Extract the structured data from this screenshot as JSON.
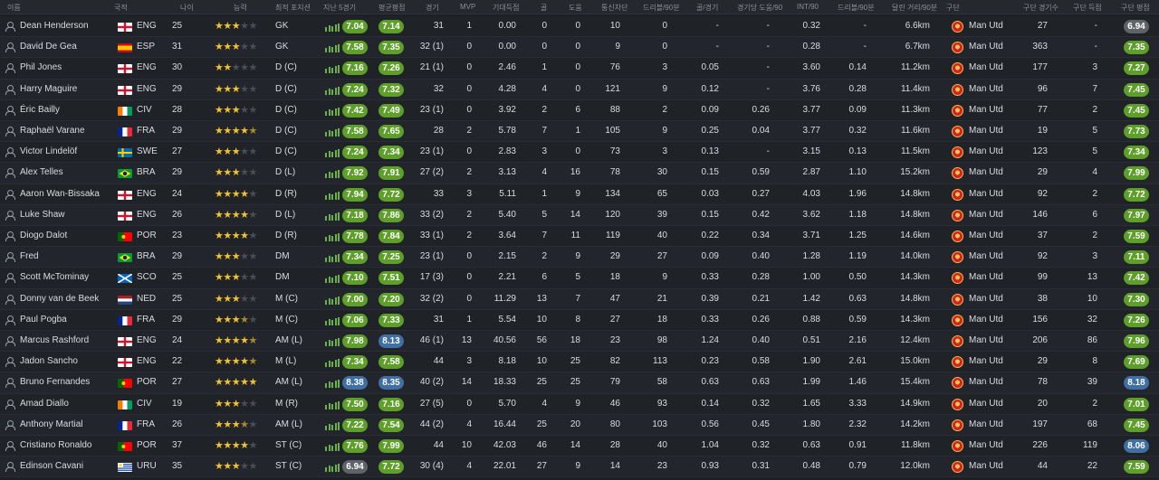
{
  "columns": [
    "이름",
    "국적",
    "나이",
    "능력",
    "최적 포지션",
    "지난 5경기",
    "평균평점",
    "경기",
    "MVP",
    "기대득점",
    "골",
    "도움",
    "통신차단",
    "드리블/90분",
    "골/경기",
    "경기당 도움/90",
    "INT/90",
    "드리블/90분",
    "달린 거리/90분",
    "구단",
    "구단 경기수",
    "구단 득점",
    "구단 평점"
  ],
  "colors": {
    "good": "#5e9f2a",
    "great": "#3f6fa3",
    "neutral": "#5f6368"
  },
  "players": [
    {
      "name": "Dean Henderson",
      "nat": "ENG",
      "flag": "eng",
      "age": "25",
      "stars": [
        1,
        1,
        1,
        0,
        0
      ],
      "pos": "GK",
      "last5": "7.04",
      "avg": "7.14",
      "apps": "31",
      "mvp": "1",
      "xg": "0.00",
      "goals": "0",
      "assists": "0",
      "intc": "10",
      "drb": "0",
      "gpg": "-",
      "apg": "-",
      "int90": "0.32",
      "drb90": "-",
      "dist": "6.6km",
      "club": "Man Utd",
      "capps": "27",
      "cgoals": "-",
      "crating": "6.94",
      "last5c": "good",
      "avgc": "good",
      "cratc": "neutral"
    },
    {
      "name": "David De Gea",
      "nat": "ESP",
      "flag": "esp",
      "age": "31",
      "stars": [
        1,
        1,
        1,
        0,
        0
      ],
      "pos": "GK",
      "last5": "7.58",
      "avg": "7.35",
      "apps": "32 (1)",
      "mvp": "0",
      "xg": "0.00",
      "goals": "0",
      "assists": "0",
      "intc": "9",
      "drb": "0",
      "gpg": "-",
      "apg": "-",
      "int90": "0.28",
      "drb90": "-",
      "dist": "6.7km",
      "club": "Man Utd",
      "capps": "363",
      "cgoals": "-",
      "crating": "7.35",
      "last5c": "good",
      "avgc": "good",
      "cratc": "good"
    },
    {
      "name": "Phil Jones",
      "nat": "ENG",
      "flag": "eng",
      "age": "30",
      "stars": [
        1,
        1,
        0,
        0,
        0
      ],
      "pos": "D (C)",
      "last5": "7.16",
      "avg": "7.26",
      "apps": "21 (1)",
      "mvp": "0",
      "xg": "2.46",
      "goals": "1",
      "assists": "0",
      "intc": "76",
      "drb": "3",
      "gpg": "0.05",
      "apg": "-",
      "int90": "3.60",
      "drb90": "0.14",
      "dist": "11.2km",
      "club": "Man Utd",
      "capps": "177",
      "cgoals": "3",
      "crating": "7.27",
      "last5c": "good",
      "avgc": "good",
      "cratc": "good"
    },
    {
      "name": "Harry Maguire",
      "nat": "ENG",
      "flag": "eng",
      "age": "29",
      "stars": [
        1,
        1,
        1,
        0,
        0
      ],
      "pos": "D (C)",
      "last5": "7.24",
      "avg": "7.32",
      "apps": "32",
      "mvp": "0",
      "xg": "4.28",
      "goals": "4",
      "assists": "0",
      "intc": "121",
      "drb": "9",
      "gpg": "0.12",
      "apg": "-",
      "int90": "3.76",
      "drb90": "0.28",
      "dist": "11.4km",
      "club": "Man Utd",
      "capps": "96",
      "cgoals": "7",
      "crating": "7.45",
      "last5c": "good",
      "avgc": "good",
      "cratc": "good"
    },
    {
      "name": "Éric Bailly",
      "nat": "CIV",
      "flag": "civ",
      "age": "28",
      "stars": [
        1,
        1,
        1,
        0,
        0
      ],
      "pos": "D (C)",
      "last5": "7.42",
      "avg": "7.49",
      "apps": "23 (1)",
      "mvp": "0",
      "xg": "3.92",
      "goals": "2",
      "assists": "6",
      "intc": "88",
      "drb": "2",
      "gpg": "0.09",
      "apg": "0.26",
      "int90": "3.77",
      "drb90": "0.09",
      "dist": "11.3km",
      "club": "Man Utd",
      "capps": "77",
      "cgoals": "2",
      "crating": "7.45",
      "last5c": "good",
      "avgc": "good",
      "cratc": "good"
    },
    {
      "name": "Raphaël Varane",
      "nat": "FRA",
      "flag": "fra",
      "age": "29",
      "stars": [
        1,
        1,
        1,
        1,
        0.5
      ],
      "pos": "D (C)",
      "last5": "7.58",
      "avg": "7.65",
      "apps": "28",
      "mvp": "2",
      "xg": "5.78",
      "goals": "7",
      "assists": "1",
      "intc": "105",
      "drb": "9",
      "gpg": "0.25",
      "apg": "0.04",
      "int90": "3.77",
      "drb90": "0.32",
      "dist": "11.6km",
      "club": "Man Utd",
      "capps": "19",
      "cgoals": "5",
      "crating": "7.73",
      "last5c": "good",
      "avgc": "good",
      "cratc": "good"
    },
    {
      "name": "Victor Lindelöf",
      "nat": "SWE",
      "flag": "swe",
      "age": "27",
      "stars": [
        1,
        1,
        1,
        0,
        0
      ],
      "pos": "D (C)",
      "last5": "7.24",
      "avg": "7.34",
      "apps": "23 (1)",
      "mvp": "0",
      "xg": "2.83",
      "goals": "3",
      "assists": "0",
      "intc": "73",
      "drb": "3",
      "gpg": "0.13",
      "apg": "-",
      "int90": "3.15",
      "drb90": "0.13",
      "dist": "11.5km",
      "club": "Man Utd",
      "capps": "123",
      "cgoals": "5",
      "crating": "7.34",
      "last5c": "good",
      "avgc": "good",
      "cratc": "good"
    },
    {
      "name": "Alex Telles",
      "nat": "BRA",
      "flag": "bra",
      "age": "29",
      "stars": [
        1,
        1,
        1,
        0,
        0
      ],
      "pos": "D (L)",
      "last5": "7.92",
      "avg": "7.91",
      "apps": "27 (2)",
      "mvp": "2",
      "xg": "3.13",
      "goals": "4",
      "assists": "16",
      "intc": "78",
      "drb": "30",
      "gpg": "0.15",
      "apg": "0.59",
      "int90": "2.87",
      "drb90": "1.10",
      "dist": "15.2km",
      "club": "Man Utd",
      "capps": "29",
      "cgoals": "4",
      "crating": "7.99",
      "last5c": "good",
      "avgc": "good",
      "cratc": "good"
    },
    {
      "name": "Aaron Wan-Bissaka",
      "nat": "ENG",
      "flag": "eng",
      "age": "24",
      "stars": [
        1,
        1,
        1,
        1,
        0
      ],
      "pos": "D (R)",
      "last5": "7.94",
      "avg": "7.72",
      "apps": "33",
      "mvp": "3",
      "xg": "5.11",
      "goals": "1",
      "assists": "9",
      "intc": "134",
      "drb": "65",
      "gpg": "0.03",
      "apg": "0.27",
      "int90": "4.03",
      "drb90": "1.96",
      "dist": "14.8km",
      "club": "Man Utd",
      "capps": "92",
      "cgoals": "2",
      "crating": "7.72",
      "last5c": "good",
      "avgc": "good",
      "cratc": "good"
    },
    {
      "name": "Luke Shaw",
      "nat": "ENG",
      "flag": "eng",
      "age": "26",
      "stars": [
        1,
        1,
        1,
        1,
        0
      ],
      "pos": "D (L)",
      "last5": "7.18",
      "avg": "7.86",
      "apps": "33 (2)",
      "mvp": "2",
      "xg": "5.40",
      "goals": "5",
      "assists": "14",
      "intc": "120",
      "drb": "39",
      "gpg": "0.15",
      "apg": "0.42",
      "int90": "3.62",
      "drb90": "1.18",
      "dist": "14.8km",
      "club": "Man Utd",
      "capps": "146",
      "cgoals": "6",
      "crating": "7.97",
      "last5c": "good",
      "avgc": "good",
      "cratc": "good"
    },
    {
      "name": "Diogo Dalot",
      "nat": "POR",
      "flag": "por",
      "age": "23",
      "stars": [
        1,
        1,
        1,
        1,
        0
      ],
      "pos": "D (R)",
      "last5": "7.78",
      "avg": "7.84",
      "apps": "33 (1)",
      "mvp": "2",
      "xg": "3.64",
      "goals": "7",
      "assists": "11",
      "intc": "119",
      "drb": "40",
      "gpg": "0.22",
      "apg": "0.34",
      "int90": "3.71",
      "drb90": "1.25",
      "dist": "14.6km",
      "club": "Man Utd",
      "capps": "37",
      "cgoals": "2",
      "crating": "7.59",
      "last5c": "good",
      "avgc": "good",
      "cratc": "good"
    },
    {
      "name": "Fred",
      "nat": "BRA",
      "flag": "bra",
      "age": "29",
      "stars": [
        1,
        1,
        1,
        0,
        0
      ],
      "pos": "DM",
      "last5": "7.34",
      "avg": "7.25",
      "apps": "23 (1)",
      "mvp": "0",
      "xg": "2.15",
      "goals": "2",
      "assists": "9",
      "intc": "29",
      "drb": "27",
      "gpg": "0.09",
      "apg": "0.40",
      "int90": "1.28",
      "drb90": "1.19",
      "dist": "14.0km",
      "club": "Man Utd",
      "capps": "92",
      "cgoals": "3",
      "crating": "7.11",
      "last5c": "good",
      "avgc": "good",
      "cratc": "good"
    },
    {
      "name": "Scott McTominay",
      "nat": "SCO",
      "flag": "sco",
      "age": "25",
      "stars": [
        1,
        1,
        1,
        0,
        0
      ],
      "pos": "DM",
      "last5": "7.10",
      "avg": "7.51",
      "apps": "17 (3)",
      "mvp": "0",
      "xg": "2.21",
      "goals": "6",
      "assists": "5",
      "intc": "18",
      "drb": "9",
      "gpg": "0.33",
      "apg": "0.28",
      "int90": "1.00",
      "drb90": "0.50",
      "dist": "14.3km",
      "club": "Man Utd",
      "capps": "99",
      "cgoals": "13",
      "crating": "7.42",
      "last5c": "good",
      "avgc": "good",
      "cratc": "good"
    },
    {
      "name": "Donny van de Beek",
      "nat": "NED",
      "flag": "ned",
      "age": "25",
      "stars": [
        1,
        1,
        1,
        0,
        0
      ],
      "pos": "M (C)",
      "last5": "7.00",
      "avg": "7.20",
      "apps": "32 (2)",
      "mvp": "0",
      "xg": "11.29",
      "goals": "13",
      "assists": "7",
      "intc": "47",
      "drb": "21",
      "gpg": "0.39",
      "apg": "0.21",
      "int90": "1.42",
      "drb90": "0.63",
      "dist": "14.8km",
      "club": "Man Utd",
      "capps": "38",
      "cgoals": "10",
      "crating": "7.30",
      "last5c": "good",
      "avgc": "good",
      "cratc": "good"
    },
    {
      "name": "Paul Pogba",
      "nat": "FRA",
      "flag": "fra",
      "age": "29",
      "stars": [
        1,
        1,
        1,
        0.5,
        0
      ],
      "pos": "M (C)",
      "last5": "7.06",
      "avg": "7.33",
      "apps": "31",
      "mvp": "1",
      "xg": "5.54",
      "goals": "10",
      "assists": "8",
      "intc": "27",
      "drb": "18",
      "gpg": "0.33",
      "apg": "0.26",
      "int90": "0.88",
      "drb90": "0.59",
      "dist": "14.3km",
      "club": "Man Utd",
      "capps": "156",
      "cgoals": "32",
      "crating": "7.26",
      "last5c": "good",
      "avgc": "good",
      "cratc": "good"
    },
    {
      "name": "Marcus Rashford",
      "nat": "ENG",
      "flag": "eng",
      "age": "24",
      "stars": [
        1,
        1,
        1,
        1,
        0.5
      ],
      "pos": "AM (L)",
      "last5": "7.98",
      "avg": "8.13",
      "apps": "46 (1)",
      "mvp": "13",
      "xg": "40.56",
      "goals": "56",
      "assists": "18",
      "intc": "23",
      "drb": "98",
      "gpg": "1.24",
      "apg": "0.40",
      "int90": "0.51",
      "drb90": "2.16",
      "dist": "12.4km",
      "club": "Man Utd",
      "capps": "206",
      "cgoals": "86",
      "crating": "7.96",
      "last5c": "good",
      "avgc": "great",
      "cratc": "good"
    },
    {
      "name": "Jadon Sancho",
      "nat": "ENG",
      "flag": "eng",
      "age": "22",
      "stars": [
        1,
        1,
        1,
        1,
        0.5
      ],
      "pos": "M (L)",
      "last5": "7.34",
      "avg": "7.58",
      "apps": "44",
      "mvp": "3",
      "xg": "8.18",
      "goals": "10",
      "assists": "25",
      "intc": "82",
      "drb": "113",
      "gpg": "0.23",
      "apg": "0.58",
      "int90": "1.90",
      "drb90": "2.61",
      "dist": "15.0km",
      "club": "Man Utd",
      "capps": "29",
      "cgoals": "8",
      "crating": "7.69",
      "last5c": "good",
      "avgc": "good",
      "cratc": "good"
    },
    {
      "name": "Bruno Fernandes",
      "nat": "POR",
      "flag": "por",
      "age": "27",
      "stars": [
        1,
        1,
        1,
        1,
        1
      ],
      "pos": "AM (L)",
      "last5": "8.38",
      "avg": "8.35",
      "apps": "40 (2)",
      "mvp": "14",
      "xg": "18.33",
      "goals": "25",
      "assists": "25",
      "intc": "79",
      "drb": "58",
      "gpg": "0.63",
      "apg": "0.63",
      "int90": "1.99",
      "drb90": "1.46",
      "dist": "15.4km",
      "club": "Man Utd",
      "capps": "78",
      "cgoals": "39",
      "crating": "8.18",
      "last5c": "great",
      "avgc": "great",
      "cratc": "great"
    },
    {
      "name": "Amad Diallo",
      "nat": "CIV",
      "flag": "civ",
      "age": "19",
      "stars": [
        1,
        1,
        1,
        0,
        0
      ],
      "pos": "M (R)",
      "last5": "7.50",
      "avg": "7.16",
      "apps": "27 (5)",
      "mvp": "0",
      "xg": "5.70",
      "goals": "4",
      "assists": "9",
      "intc": "46",
      "drb": "93",
      "gpg": "0.14",
      "apg": "0.32",
      "int90": "1.65",
      "drb90": "3.33",
      "dist": "14.9km",
      "club": "Man Utd",
      "capps": "20",
      "cgoals": "2",
      "crating": "7.01",
      "last5c": "good",
      "avgc": "good",
      "cratc": "good"
    },
    {
      "name": "Anthony Martial",
      "nat": "FRA",
      "flag": "fra",
      "age": "26",
      "stars": [
        1,
        1,
        1,
        0.5,
        0
      ],
      "pos": "AM (L)",
      "last5": "7.22",
      "avg": "7.54",
      "apps": "44 (2)",
      "mvp": "4",
      "xg": "16.44",
      "goals": "25",
      "assists": "20",
      "intc": "80",
      "drb": "103",
      "gpg": "0.56",
      "apg": "0.45",
      "int90": "1.80",
      "drb90": "2.32",
      "dist": "14.2km",
      "club": "Man Utd",
      "capps": "197",
      "cgoals": "68",
      "crating": "7.45",
      "last5c": "good",
      "avgc": "good",
      "cratc": "good"
    },
    {
      "name": "Cristiano Ronaldo",
      "nat": "POR",
      "flag": "por",
      "age": "37",
      "stars": [
        1,
        1,
        1,
        1,
        0
      ],
      "pos": "ST (C)",
      "last5": "7.76",
      "avg": "7.99",
      "apps": "44",
      "mvp": "10",
      "xg": "42.03",
      "goals": "46",
      "assists": "14",
      "intc": "28",
      "drb": "40",
      "gpg": "1.04",
      "apg": "0.32",
      "int90": "0.63",
      "drb90": "0.91",
      "dist": "11.8km",
      "club": "Man Utd",
      "capps": "226",
      "cgoals": "119",
      "crating": "8.06",
      "last5c": "good",
      "avgc": "good",
      "cratc": "great"
    },
    {
      "name": "Edinson Cavani",
      "nat": "URU",
      "flag": "uru",
      "age": "35",
      "stars": [
        1,
        1,
        1,
        0,
        0
      ],
      "pos": "ST (C)",
      "last5": "6.94",
      "avg": "7.72",
      "apps": "30 (4)",
      "mvp": "4",
      "xg": "22.01",
      "goals": "27",
      "assists": "9",
      "intc": "14",
      "drb": "23",
      "gpg": "0.93",
      "apg": "0.31",
      "int90": "0.48",
      "drb90": "0.79",
      "dist": "12.0km",
      "club": "Man Utd",
      "capps": "44",
      "cgoals": "22",
      "crating": "7.59",
      "last5c": "neutral",
      "avgc": "good",
      "cratc": "good"
    }
  ]
}
